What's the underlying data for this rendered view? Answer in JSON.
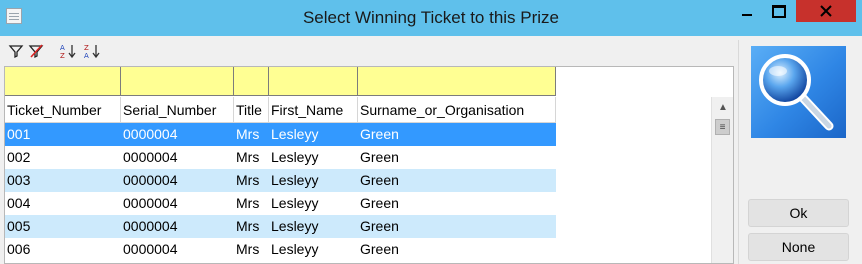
{
  "window": {
    "title": "Select Winning Ticket to this Prize",
    "buttons": [
      "minimize",
      "maximize",
      "close"
    ]
  },
  "toolbar": {
    "icons": [
      "filter-icon",
      "clear-filter-icon",
      "sort-ascending-icon",
      "sort-descending-icon"
    ]
  },
  "grid": {
    "columns": [
      "Ticket_Number",
      "Serial_Number",
      "Title",
      "First_Name",
      "Surname_or_Organisation"
    ],
    "rows": [
      {
        "ticket": "001",
        "serial": "0000004",
        "title": "Mrs",
        "first": "Lesleyy",
        "surname": "Green",
        "state": "selected"
      },
      {
        "ticket": "002",
        "serial": "0000004",
        "title": "Mrs",
        "first": "Lesleyy",
        "surname": "Green",
        "state": "white"
      },
      {
        "ticket": "003",
        "serial": "0000004",
        "title": "Mrs",
        "first": "Lesleyy",
        "surname": "Green",
        "state": "alt"
      },
      {
        "ticket": "004",
        "serial": "0000004",
        "title": "Mrs",
        "first": "Lesleyy",
        "surname": "Green",
        "state": "white"
      },
      {
        "ticket": "005",
        "serial": "0000004",
        "title": "Mrs",
        "first": "Lesleyy",
        "surname": "Green",
        "state": "alt"
      },
      {
        "ticket": "006",
        "serial": "0000004",
        "title": "Mrs",
        "first": "Lesleyy",
        "surname": "Green",
        "state": "white"
      }
    ]
  },
  "panel": {
    "ok_label": "Ok",
    "none_label": "None"
  },
  "colors": {
    "titlebar": "#5fc0eb",
    "filter_row": "#ffff93",
    "selected_row": "#3399ff",
    "alt_row": "#cdeafc",
    "close_button": "#c7312c"
  }
}
